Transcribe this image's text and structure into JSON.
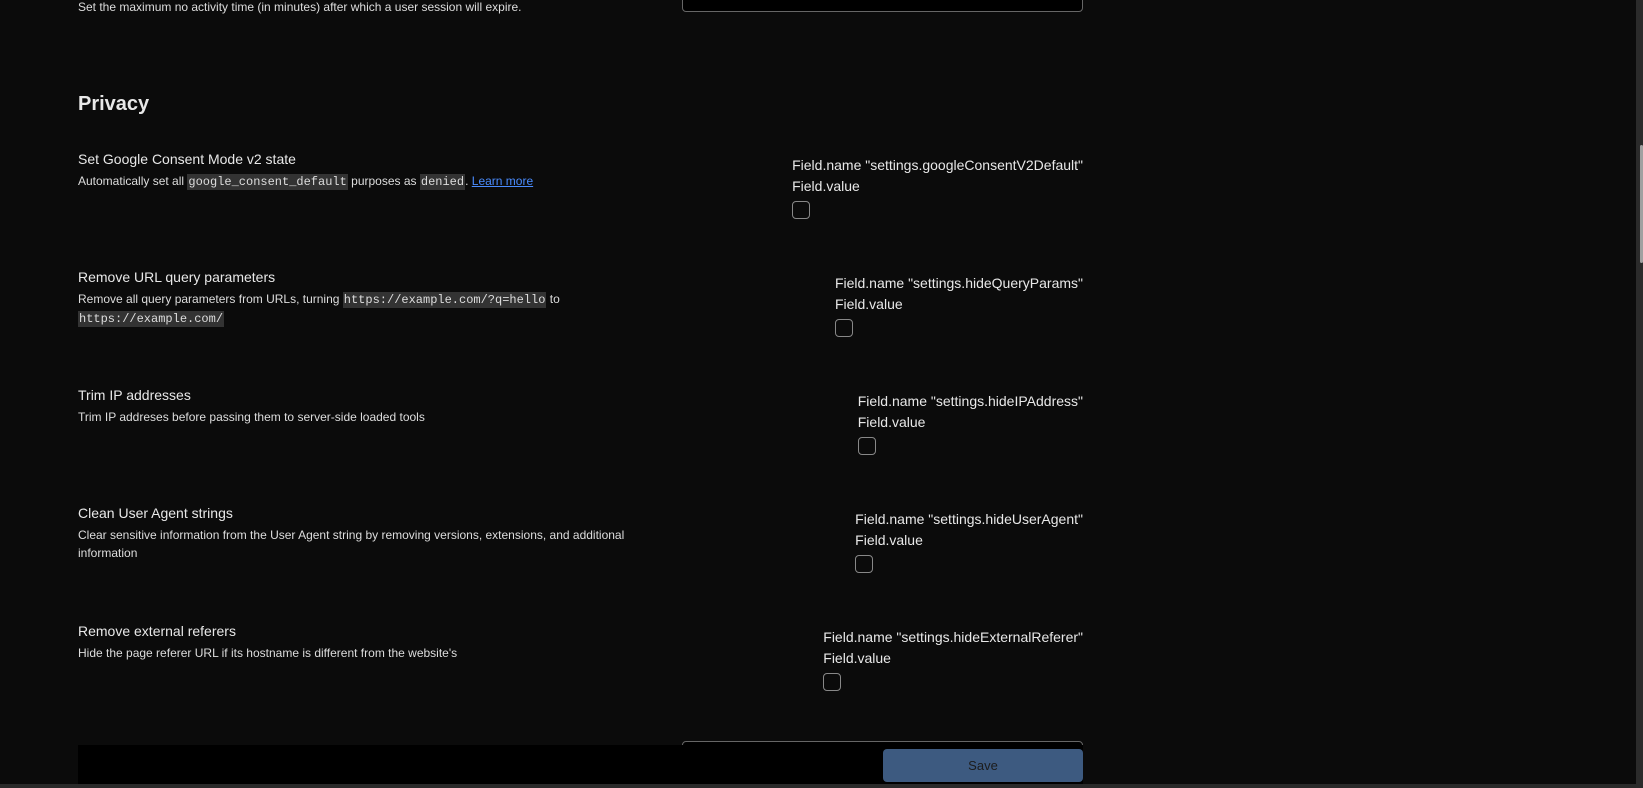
{
  "previous": {
    "description": "Set the maximum no activity time (in minutes) after which a user session will expire."
  },
  "section": {
    "heading": "Privacy"
  },
  "settings": [
    {
      "title": "Set Google Consent Mode v2 state",
      "desc_parts": [
        "Automatically set all ",
        "google_consent_default",
        " purposes as ",
        "denied",
        ". "
      ],
      "link": "Learn more",
      "field_name": "Field.name \"settings.googleConsentV2Default\"",
      "field_value": "Field.value",
      "checked": false
    },
    {
      "title": "Remove URL query parameters",
      "desc_parts": [
        "Remove all query parameters from URLs, turning ",
        "https://example.com/?q=hello",
        " to ",
        "https://example.com/"
      ],
      "field_name": "Field.name \"settings.hideQueryParams\"",
      "field_value": "Field.value",
      "checked": false
    },
    {
      "title": "Trim IP addresses",
      "desc": "Trim IP addreses before passing them to server-side loaded tools",
      "field_name": "Field.name \"settings.hideIPAddress\"",
      "field_value": "Field.value",
      "checked": false
    },
    {
      "title": "Clean User Agent strings",
      "desc": "Clear sensitive information from the User Agent string by removing versions, extensions, and additional information",
      "field_name": "Field.name \"settings.hideUserAgent\"",
      "field_value": "Field.value",
      "checked": false
    },
    {
      "title": "Remove external referers",
      "desc": "Hide the page referer URL if its hostname is different from the website's",
      "field_name": "Field.name \"settings.hideExternalReferer\"",
      "field_value": "Field.value",
      "checked": false
    }
  ],
  "footer": {
    "save_label": "Save"
  },
  "colors": {
    "background": "#0b0b0b",
    "link": "#4a8cff",
    "save_button": "#3d5a80",
    "code_bg": "#333333"
  }
}
